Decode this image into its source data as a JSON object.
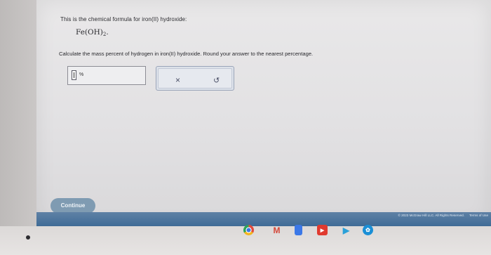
{
  "problem": {
    "intro": "This is the chemical formula for iron(II) hydroxide:",
    "formula_main": "Fe(OH)",
    "formula_sub": "2",
    "formula_end": ".",
    "question": "Calculate the mass percent of hydrogen in iron(II) hydroxide. Round your answer to the nearest percentage."
  },
  "answer": {
    "value": "",
    "unit": "%"
  },
  "tools": {
    "clear_icon": "×",
    "undo_icon": "↺"
  },
  "footer": {
    "continue_label": "Continue",
    "copyright": "© 2023 McGraw Hill LLC. All Rights Reserved.",
    "terms": "Terms of Use"
  },
  "taskbar": {
    "apps": [
      "chrome-icon",
      "gmail-icon",
      "docs-icon",
      "youtube-icon",
      "play-store-icon",
      "photos-icon"
    ]
  },
  "colors": {
    "footer_bar": "#4a739c",
    "continue_button": "#7f9bb2",
    "text": "#2a2a2e"
  }
}
